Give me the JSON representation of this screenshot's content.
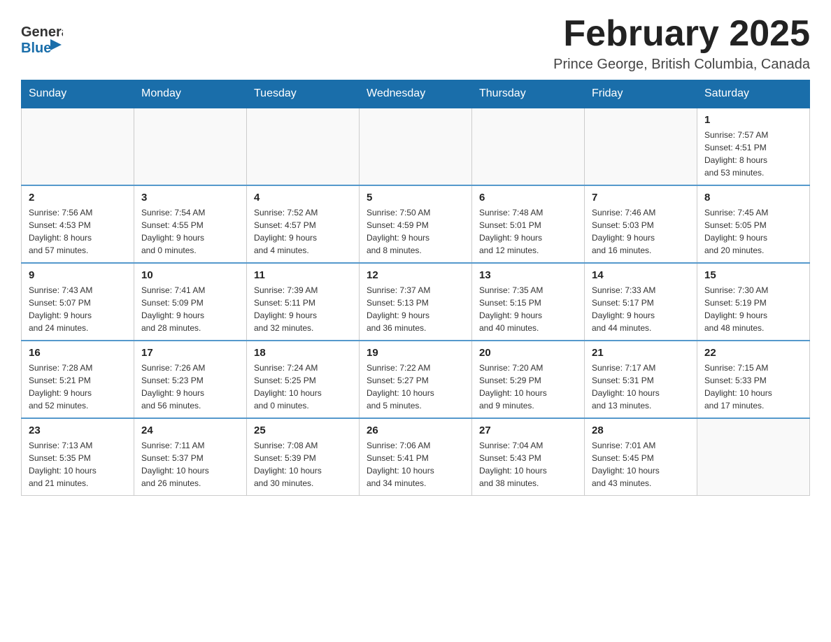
{
  "header": {
    "logo": {
      "general": "General",
      "blue": "Blue"
    },
    "title": "February 2025",
    "location": "Prince George, British Columbia, Canada"
  },
  "weekdays": [
    "Sunday",
    "Monday",
    "Tuesday",
    "Wednesday",
    "Thursday",
    "Friday",
    "Saturday"
  ],
  "weeks": [
    [
      {
        "day": "",
        "info": ""
      },
      {
        "day": "",
        "info": ""
      },
      {
        "day": "",
        "info": ""
      },
      {
        "day": "",
        "info": ""
      },
      {
        "day": "",
        "info": ""
      },
      {
        "day": "",
        "info": ""
      },
      {
        "day": "1",
        "info": "Sunrise: 7:57 AM\nSunset: 4:51 PM\nDaylight: 8 hours\nand 53 minutes."
      }
    ],
    [
      {
        "day": "2",
        "info": "Sunrise: 7:56 AM\nSunset: 4:53 PM\nDaylight: 8 hours\nand 57 minutes."
      },
      {
        "day": "3",
        "info": "Sunrise: 7:54 AM\nSunset: 4:55 PM\nDaylight: 9 hours\nand 0 minutes."
      },
      {
        "day": "4",
        "info": "Sunrise: 7:52 AM\nSunset: 4:57 PM\nDaylight: 9 hours\nand 4 minutes."
      },
      {
        "day": "5",
        "info": "Sunrise: 7:50 AM\nSunset: 4:59 PM\nDaylight: 9 hours\nand 8 minutes."
      },
      {
        "day": "6",
        "info": "Sunrise: 7:48 AM\nSunset: 5:01 PM\nDaylight: 9 hours\nand 12 minutes."
      },
      {
        "day": "7",
        "info": "Sunrise: 7:46 AM\nSunset: 5:03 PM\nDaylight: 9 hours\nand 16 minutes."
      },
      {
        "day": "8",
        "info": "Sunrise: 7:45 AM\nSunset: 5:05 PM\nDaylight: 9 hours\nand 20 minutes."
      }
    ],
    [
      {
        "day": "9",
        "info": "Sunrise: 7:43 AM\nSunset: 5:07 PM\nDaylight: 9 hours\nand 24 minutes."
      },
      {
        "day": "10",
        "info": "Sunrise: 7:41 AM\nSunset: 5:09 PM\nDaylight: 9 hours\nand 28 minutes."
      },
      {
        "day": "11",
        "info": "Sunrise: 7:39 AM\nSunset: 5:11 PM\nDaylight: 9 hours\nand 32 minutes."
      },
      {
        "day": "12",
        "info": "Sunrise: 7:37 AM\nSunset: 5:13 PM\nDaylight: 9 hours\nand 36 minutes."
      },
      {
        "day": "13",
        "info": "Sunrise: 7:35 AM\nSunset: 5:15 PM\nDaylight: 9 hours\nand 40 minutes."
      },
      {
        "day": "14",
        "info": "Sunrise: 7:33 AM\nSunset: 5:17 PM\nDaylight: 9 hours\nand 44 minutes."
      },
      {
        "day": "15",
        "info": "Sunrise: 7:30 AM\nSunset: 5:19 PM\nDaylight: 9 hours\nand 48 minutes."
      }
    ],
    [
      {
        "day": "16",
        "info": "Sunrise: 7:28 AM\nSunset: 5:21 PM\nDaylight: 9 hours\nand 52 minutes."
      },
      {
        "day": "17",
        "info": "Sunrise: 7:26 AM\nSunset: 5:23 PM\nDaylight: 9 hours\nand 56 minutes."
      },
      {
        "day": "18",
        "info": "Sunrise: 7:24 AM\nSunset: 5:25 PM\nDaylight: 10 hours\nand 0 minutes."
      },
      {
        "day": "19",
        "info": "Sunrise: 7:22 AM\nSunset: 5:27 PM\nDaylight: 10 hours\nand 5 minutes."
      },
      {
        "day": "20",
        "info": "Sunrise: 7:20 AM\nSunset: 5:29 PM\nDaylight: 10 hours\nand 9 minutes."
      },
      {
        "day": "21",
        "info": "Sunrise: 7:17 AM\nSunset: 5:31 PM\nDaylight: 10 hours\nand 13 minutes."
      },
      {
        "day": "22",
        "info": "Sunrise: 7:15 AM\nSunset: 5:33 PM\nDaylight: 10 hours\nand 17 minutes."
      }
    ],
    [
      {
        "day": "23",
        "info": "Sunrise: 7:13 AM\nSunset: 5:35 PM\nDaylight: 10 hours\nand 21 minutes."
      },
      {
        "day": "24",
        "info": "Sunrise: 7:11 AM\nSunset: 5:37 PM\nDaylight: 10 hours\nand 26 minutes."
      },
      {
        "day": "25",
        "info": "Sunrise: 7:08 AM\nSunset: 5:39 PM\nDaylight: 10 hours\nand 30 minutes."
      },
      {
        "day": "26",
        "info": "Sunrise: 7:06 AM\nSunset: 5:41 PM\nDaylight: 10 hours\nand 34 minutes."
      },
      {
        "day": "27",
        "info": "Sunrise: 7:04 AM\nSunset: 5:43 PM\nDaylight: 10 hours\nand 38 minutes."
      },
      {
        "day": "28",
        "info": "Sunrise: 7:01 AM\nSunset: 5:45 PM\nDaylight: 10 hours\nand 43 minutes."
      },
      {
        "day": "",
        "info": ""
      }
    ]
  ]
}
